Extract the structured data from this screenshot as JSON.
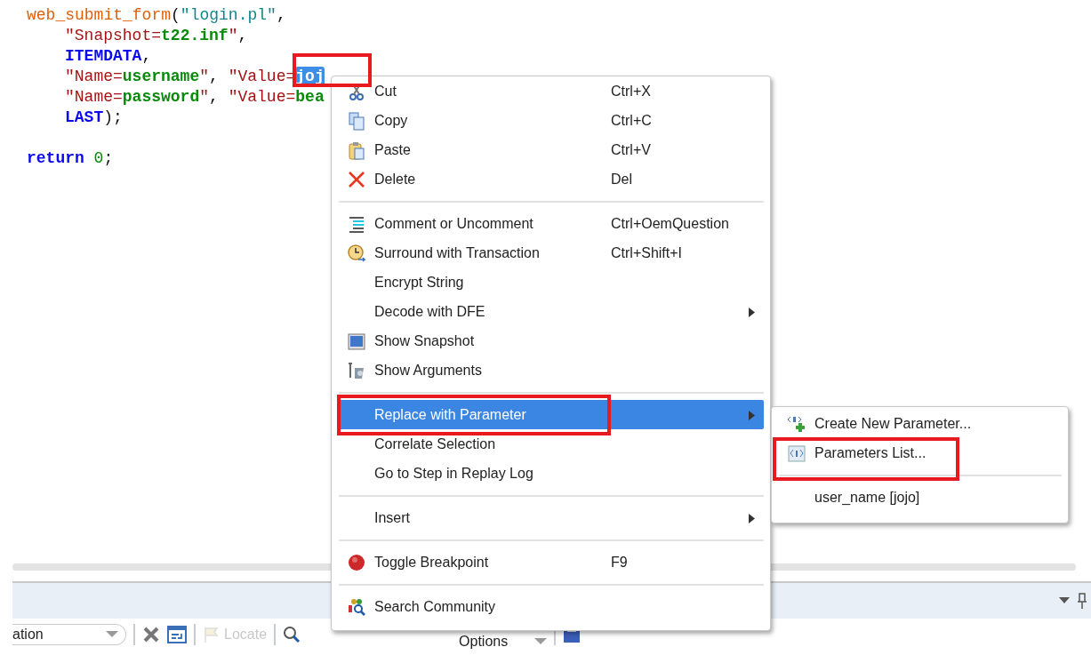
{
  "code": {
    "lines": [
      {
        "kind": "code",
        "indent": false,
        "tokens": [
          {
            "kind": "fn",
            "text": "web_submit_form"
          },
          {
            "kind": "punct",
            "text": "("
          },
          {
            "kind": "str2",
            "text": "\"login.pl\""
          },
          {
            "kind": "punct",
            "text": ","
          }
        ]
      },
      {
        "kind": "code",
        "indent": true,
        "tokens": [
          {
            "kind": "str",
            "text": "\"Snapshot="
          },
          {
            "kind": "val",
            "text": "t22.inf"
          },
          {
            "kind": "str",
            "text": "\""
          },
          {
            "kind": "punct",
            "text": ","
          }
        ]
      },
      {
        "kind": "code",
        "indent": true,
        "tokens": [
          {
            "kind": "kw",
            "text": "ITEMDATA"
          },
          {
            "kind": "punct",
            "text": ","
          }
        ]
      },
      {
        "kind": "code",
        "indent": true,
        "tokens": [
          {
            "kind": "str",
            "text": "\"Name="
          },
          {
            "kind": "val",
            "text": "username"
          },
          {
            "kind": "str",
            "text": "\""
          },
          {
            "kind": "punct",
            "text": ", "
          },
          {
            "kind": "str",
            "text": "\"Value="
          },
          {
            "kind": "sel",
            "text": "joj"
          }
        ]
      },
      {
        "kind": "code",
        "indent": true,
        "tokens": [
          {
            "kind": "str",
            "text": "\"Name="
          },
          {
            "kind": "val",
            "text": "password"
          },
          {
            "kind": "str",
            "text": "\""
          },
          {
            "kind": "punct",
            "text": ", "
          },
          {
            "kind": "str",
            "text": "\"Value="
          },
          {
            "kind": "val",
            "text": "bea"
          }
        ]
      },
      {
        "kind": "code",
        "indent": true,
        "tokens": [
          {
            "kind": "kw",
            "text": "LAST"
          },
          {
            "kind": "punct",
            "text": ");"
          }
        ]
      },
      {
        "kind": "blank"
      },
      {
        "kind": "code",
        "indent": false,
        "tokens": [
          {
            "kind": "kw",
            "text": "return"
          },
          {
            "kind": "num",
            "text": "0",
            "space_before": true
          },
          {
            "kind": "punct",
            "text": ";"
          }
        ]
      }
    ]
  },
  "context_menu": {
    "items": [
      {
        "kind": "item",
        "label": "Cut",
        "shortcut": "Ctrl+X",
        "submenu": false,
        "selected": false
      },
      {
        "kind": "item",
        "label": "Copy",
        "shortcut": "Ctrl+C",
        "submenu": false,
        "selected": false
      },
      {
        "kind": "item",
        "label": "Paste",
        "shortcut": "Ctrl+V",
        "submenu": false,
        "selected": false
      },
      {
        "kind": "item",
        "label": "Delete",
        "shortcut": "Del",
        "submenu": false,
        "selected": false
      },
      {
        "kind": "separator"
      },
      {
        "kind": "item",
        "label": "Comment or Uncomment",
        "shortcut": "Ctrl+OemQuestion",
        "submenu": false,
        "selected": false
      },
      {
        "kind": "item",
        "label": "Surround with Transaction",
        "shortcut": "Ctrl+Shift+I",
        "submenu": false,
        "selected": false
      },
      {
        "kind": "item",
        "label": "Encrypt String",
        "submenu": false,
        "selected": false
      },
      {
        "kind": "item",
        "label": "Decode with DFE",
        "submenu": true,
        "selected": false
      },
      {
        "kind": "item",
        "label": "Show Snapshot",
        "submenu": false,
        "selected": false
      },
      {
        "kind": "item",
        "label": "Show Arguments",
        "submenu": false,
        "selected": false
      },
      {
        "kind": "separator"
      },
      {
        "kind": "item",
        "label": "Replace with Parameter",
        "submenu": true,
        "selected": true
      },
      {
        "kind": "item",
        "label": "Correlate Selection",
        "submenu": false,
        "selected": false
      },
      {
        "kind": "item",
        "label": "Go to Step in Replay Log",
        "submenu": false,
        "selected": false
      },
      {
        "kind": "separator"
      },
      {
        "kind": "item",
        "label": "Insert",
        "submenu": true,
        "selected": false
      },
      {
        "kind": "separator"
      },
      {
        "kind": "item",
        "label": "Toggle Breakpoint",
        "shortcut": "F9",
        "submenu": false,
        "selected": false
      },
      {
        "kind": "separator"
      },
      {
        "kind": "item",
        "label": "Search Community",
        "submenu": false,
        "selected": false
      }
    ]
  },
  "submenu": {
    "items": [
      {
        "kind": "item",
        "label": "Create New Parameter..."
      },
      {
        "kind": "item",
        "label": "Parameters List..."
      },
      {
        "kind": "separator"
      },
      {
        "kind": "item",
        "label": "user_name [jojo]"
      }
    ]
  },
  "toolbar": {
    "combo_value": "ation",
    "locate": {
      "label": "Locate",
      "disabled": true
    },
    "options_label": "Options"
  }
}
